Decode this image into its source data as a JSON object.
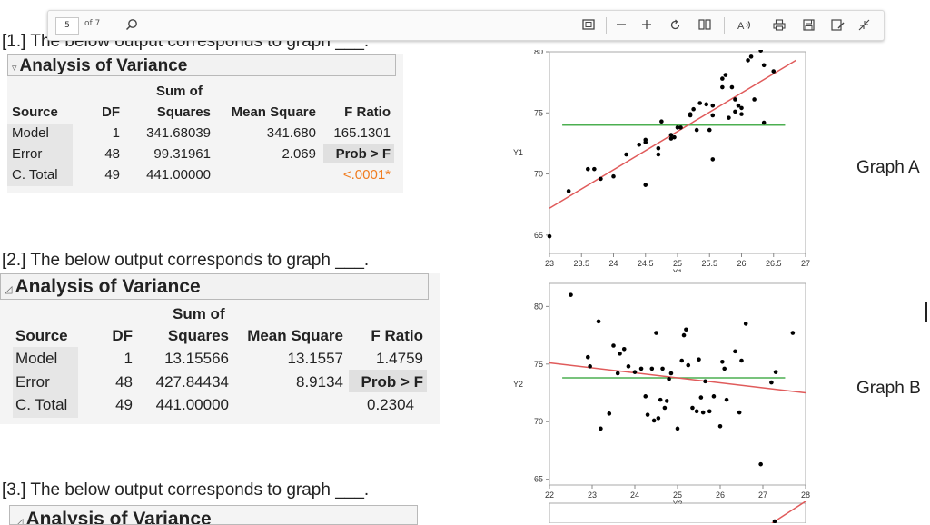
{
  "toolbar": {
    "page_number": "5",
    "page_total": "of 7",
    "icons": [
      "search-icon",
      "fit-page-icon",
      "zoom-out-icon",
      "zoom-in-icon",
      "rotate-icon",
      "page-view-icon",
      "read-aloud-icon",
      "print-icon",
      "save-icon",
      "save-as-icon",
      "collapse-icon"
    ]
  },
  "questions": [
    "[1.] The below output corresponds to graph ___.",
    "[2.] The below output corresponds to graph ___.",
    "[3.] The below output corresponds to graph ___."
  ],
  "anova_title": "Analysis of Variance",
  "anova_headers": {
    "source": "Source",
    "df": "DF",
    "ss_top": "Sum of",
    "ss_bottom": "Squares",
    "ms": "Mean Square",
    "f": "F Ratio",
    "prob": "Prob > F"
  },
  "anova1": {
    "rows": [
      {
        "source": "Model",
        "df": "1",
        "ss": "341.68039",
        "ms": "341.680",
        "f": "165.1301"
      },
      {
        "source": "Error",
        "df": "48",
        "ss": "99.31961",
        "ms": "2.069"
      },
      {
        "source": "C. Total",
        "df": "49",
        "ss": "441.00000"
      }
    ],
    "prob_value": "<.0001*",
    "prob_color": "#f07c1f"
  },
  "anova2": {
    "rows": [
      {
        "source": "Model",
        "df": "1",
        "ss": "13.15566",
        "ms": "13.1557",
        "f": "1.4759"
      },
      {
        "source": "Error",
        "df": "48",
        "ss": "427.84434",
        "ms": "8.9134"
      },
      {
        "source": "C. Total",
        "df": "49",
        "ss": "441.00000"
      }
    ],
    "prob_value": "0.2304"
  },
  "graph_labels": [
    "Graph A",
    "Graph B"
  ],
  "chart_data": [
    {
      "type": "scatter",
      "xlabel": "X1",
      "ylabel": "Y1",
      "xlim": [
        23,
        27
      ],
      "ylim": [
        63.5,
        80
      ],
      "xticks": [
        "23",
        "23.5",
        "24",
        "24.5",
        "25",
        "25.5",
        "26",
        "26.5",
        "27"
      ],
      "yticks": [
        "65",
        "70",
        "75",
        "80"
      ],
      "mean_line": 74.0,
      "fit_line": {
        "x": [
          23,
          26.85
        ],
        "y": [
          67.2,
          79.3
        ]
      },
      "line_colors": {
        "fit": "#e05b5b",
        "mean": "#4caf50"
      },
      "points": [
        [
          23.0,
          64.9
        ],
        [
          23.3,
          68.6
        ],
        [
          23.6,
          70.4
        ],
        [
          23.7,
          70.4
        ],
        [
          23.8,
          69.6
        ],
        [
          24.0,
          69.8
        ],
        [
          24.2,
          71.6
        ],
        [
          24.4,
          72.4
        ],
        [
          24.5,
          72.6
        ],
        [
          24.5,
          72.8
        ],
        [
          24.5,
          69.1
        ],
        [
          24.7,
          72.1
        ],
        [
          24.7,
          71.6
        ],
        [
          24.75,
          74.3
        ],
        [
          24.9,
          73.2
        ],
        [
          24.9,
          72.9
        ],
        [
          25.0,
          73.8
        ],
        [
          25.05,
          73.8
        ],
        [
          25.2,
          74.9
        ],
        [
          25.25,
          75.3
        ],
        [
          25.3,
          73.6
        ],
        [
          25.35,
          75.8
        ],
        [
          25.45,
          75.7
        ],
        [
          25.5,
          73.6
        ],
        [
          25.55,
          71.2
        ],
        [
          25.55,
          75.6
        ],
        [
          25.7,
          77.1
        ],
        [
          25.75,
          78.1
        ],
        [
          25.8,
          74.6
        ],
        [
          25.9,
          75.1
        ],
        [
          25.9,
          76.1
        ],
        [
          25.95,
          75.6
        ],
        [
          26.0,
          74.9
        ],
        [
          26.0,
          75.4
        ],
        [
          26.1,
          79.3
        ],
        [
          26.15,
          79.6
        ],
        [
          26.3,
          80.1
        ],
        [
          26.35,
          78.9
        ],
        [
          26.5,
          78.4
        ],
        [
          26.35,
          74.2
        ],
        [
          25.7,
          77.8
        ],
        [
          25.85,
          77.1
        ],
        [
          25.55,
          74.8
        ],
        [
          25.2,
          74.8
        ],
        [
          24.95,
          73.0
        ],
        [
          26.2,
          76.1
        ]
      ]
    },
    {
      "type": "scatter",
      "xlabel": "X2",
      "ylabel": "Y2",
      "xlim": [
        22,
        28
      ],
      "ylim": [
        64.5,
        82
      ],
      "xticks": [
        "22",
        "23",
        "24",
        "25",
        "26",
        "27",
        "28"
      ],
      "yticks": [
        "65",
        "70",
        "75",
        "80"
      ],
      "mean_line": 73.8,
      "fit_line": {
        "x": [
          22,
          28
        ],
        "y": [
          75.1,
          72.5
        ]
      },
      "line_colors": {
        "fit": "#e05b5b",
        "mean": "#4caf50"
      },
      "points": [
        [
          22.5,
          81.0
        ],
        [
          22.9,
          75.6
        ],
        [
          22.95,
          74.8
        ],
        [
          23.15,
          78.7
        ],
        [
          23.2,
          69.4
        ],
        [
          23.4,
          70.7
        ],
        [
          23.5,
          76.6
        ],
        [
          23.6,
          74.2
        ],
        [
          23.65,
          75.9
        ],
        [
          23.75,
          76.3
        ],
        [
          23.85,
          74.8
        ],
        [
          24.0,
          74.3
        ],
        [
          24.15,
          74.6
        ],
        [
          24.25,
          72.2
        ],
        [
          24.3,
          70.6
        ],
        [
          24.4,
          74.6
        ],
        [
          24.45,
          70.1
        ],
        [
          24.5,
          77.7
        ],
        [
          24.55,
          70.3
        ],
        [
          24.6,
          71.9
        ],
        [
          24.65,
          74.6
        ],
        [
          24.7,
          71.2
        ],
        [
          24.75,
          71.8
        ],
        [
          24.8,
          73.7
        ],
        [
          24.85,
          74.2
        ],
        [
          25.0,
          69.4
        ],
        [
          25.1,
          75.3
        ],
        [
          25.15,
          77.5
        ],
        [
          25.2,
          78.0
        ],
        [
          25.25,
          74.9
        ],
        [
          25.35,
          71.2
        ],
        [
          25.45,
          70.9
        ],
        [
          25.5,
          75.4
        ],
        [
          25.55,
          72.1
        ],
        [
          25.6,
          70.8
        ],
        [
          25.65,
          73.5
        ],
        [
          25.75,
          70.9
        ],
        [
          25.85,
          72.2
        ],
        [
          26.0,
          69.6
        ],
        [
          26.05,
          75.2
        ],
        [
          26.1,
          74.6
        ],
        [
          26.15,
          71.9
        ],
        [
          26.35,
          76.1
        ],
        [
          26.45,
          70.8
        ],
        [
          26.5,
          75.3
        ],
        [
          26.6,
          78.5
        ],
        [
          26.95,
          66.3
        ],
        [
          27.2,
          73.4
        ],
        [
          27.3,
          74.3
        ],
        [
          27.7,
          77.7
        ]
      ]
    }
  ]
}
